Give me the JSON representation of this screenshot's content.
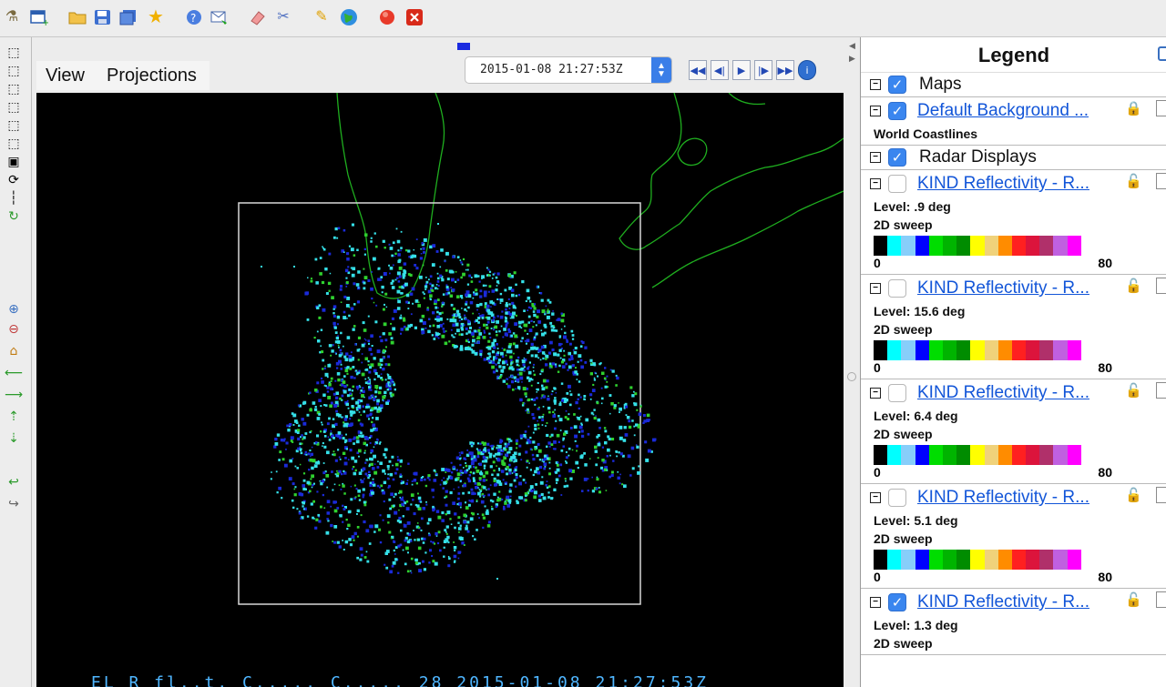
{
  "toolbar": {
    "icons": [
      "wand-icon",
      "new-window-icon",
      "open-folder-icon",
      "save-icon",
      "save-all-icon",
      "favorite-star-icon",
      "help-icon",
      "send-icon",
      "eraser-icon",
      "cut-icon",
      "pencil-icon",
      "globe-icon",
      "record-icon",
      "close-red-icon"
    ]
  },
  "left_tools": {
    "icons": [
      "view-top-icon",
      "view-bottom-icon",
      "view-north-icon",
      "view-east-icon",
      "view-south-icon",
      "view-west-icon",
      "view-box-icon",
      "rotate-3d-icon",
      "slider-icon",
      "reset-rotate-icon",
      "zoom-in-icon",
      "zoom-out-icon",
      "home-icon",
      "pan-left-icon",
      "pan-right-icon",
      "pan-up-icon",
      "pan-down-icon",
      "undo-icon",
      "redo-icon"
    ]
  },
  "menu": {
    "view": "View",
    "projections": "Projections"
  },
  "time": {
    "value": "2015-01-08 21:27:53Z"
  },
  "animation": {
    "buttons": [
      "◀◀",
      "◀|",
      "▶",
      "|▶",
      "▶▶",
      "i"
    ]
  },
  "canvas": {
    "bottom_label": "EL R  fl..t.      C..... C.....        28 2015-01-08 21:27:53Z"
  },
  "legend": {
    "title": "Legend",
    "maps_group": {
      "label": "Maps",
      "checked": true
    },
    "map_layer": {
      "label": "Default Background ...",
      "sub": "World Coastlines",
      "checked": true
    },
    "radar_group": {
      "label": "Radar Displays",
      "checked": true
    },
    "radar_layers": [
      {
        "label": "KIND Reflectivity - R...",
        "level": "Level: .9 deg",
        "kind": "2D sweep",
        "min": "0",
        "max": "80",
        "checked": false
      },
      {
        "label": "KIND Reflectivity - R...",
        "level": "Level: 15.6 deg",
        "kind": "2D sweep",
        "min": "0",
        "max": "80",
        "checked": false
      },
      {
        "label": "KIND Reflectivity - R...",
        "level": "Level: 6.4 deg",
        "kind": "2D sweep",
        "min": "0",
        "max": "80",
        "checked": false
      },
      {
        "label": "KIND Reflectivity - R...",
        "level": "Level: 5.1 deg",
        "kind": "2D sweep",
        "min": "0",
        "max": "80",
        "checked": false
      },
      {
        "label": "KIND Reflectivity - R...",
        "level": "Level: 1.3 deg",
        "kind": "2D sweep",
        "min": "",
        "max": "",
        "checked": true
      }
    ],
    "colorbar_colors": [
      "#000000",
      "#00ffff",
      "#87cefa",
      "#0000ff",
      "#00dd00",
      "#00b400",
      "#008c00",
      "#ffff00",
      "#f0d27a",
      "#ff8c00",
      "#ff2020",
      "#dc143c",
      "#b0306a",
      "#c060e0",
      "#ff00ff",
      "#ffffff"
    ]
  },
  "colors": {
    "accent": "#3a86ef",
    "coastline": "#1fae1f",
    "box": "#d8d8d8",
    "echo_cyan": "#35e0e8",
    "echo_blue": "#1a2ad8",
    "echo_green": "#2fd12f"
  }
}
